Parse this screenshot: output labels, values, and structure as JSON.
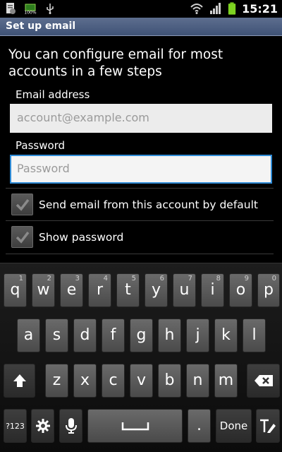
{
  "status_bar": {
    "time": "15:21",
    "icons": [
      "document-icon",
      "battery-percent-icon",
      "usb-icon",
      "wifi-icon",
      "signal-icon",
      "battery-icon"
    ]
  },
  "app_bar": {
    "title": "Set up email"
  },
  "intro_text": "You can configure email for most accounts in a few steps",
  "form": {
    "email": {
      "label": "Email address",
      "placeholder": "account@example.com"
    },
    "password": {
      "label": "Password",
      "placeholder": "Password"
    },
    "checkboxes": [
      {
        "label": "Send email from this account by default",
        "checked": true
      },
      {
        "label": "Show password",
        "checked": true
      }
    ]
  },
  "keyboard": {
    "row1": [
      {
        "ch": "q",
        "num": "1"
      },
      {
        "ch": "w",
        "num": "2"
      },
      {
        "ch": "e",
        "num": "3"
      },
      {
        "ch": "r",
        "num": "4"
      },
      {
        "ch": "t",
        "num": "5"
      },
      {
        "ch": "y",
        "num": "6"
      },
      {
        "ch": "u",
        "num": "7"
      },
      {
        "ch": "i",
        "num": "8"
      },
      {
        "ch": "o",
        "num": "9"
      },
      {
        "ch": "p",
        "num": "0"
      }
    ],
    "row2": [
      "a",
      "s",
      "d",
      "f",
      "g",
      "h",
      "j",
      "k",
      "l"
    ],
    "row3": [
      "z",
      "x",
      "c",
      "v",
      "b",
      "n",
      "m"
    ],
    "symbols_label": "?123",
    "period_label": ".",
    "done_label": "Done",
    "icons": {
      "shift": "shift-icon",
      "backspace": "backspace-icon",
      "settings": "gear-icon",
      "voice": "microphone-icon",
      "space": "space-icon",
      "text_mode": "text-mode-icon"
    }
  }
}
